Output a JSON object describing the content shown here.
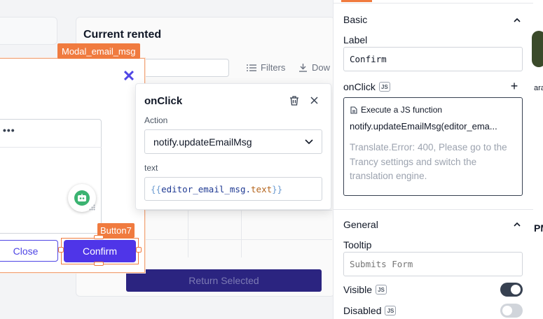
{
  "background": {
    "table_title": "Current rented",
    "filters_label": "Filters",
    "download_label": "Dow",
    "return_button": "Return Selected"
  },
  "modal": {
    "tag": "Modal_email_msg",
    "close_glyph": "✕",
    "editor_menu_glyph": "•••",
    "close_button": "Close",
    "confirm_button": "Confirm",
    "button_tag": "Button7"
  },
  "onclick_popover": {
    "title": "onClick",
    "action_label": "Action",
    "action_value": "notify.updateEmailMsg",
    "text_label": "text",
    "text_value": {
      "open": "{{",
      "object": "editor_email_msg",
      "dot": ".",
      "property": "text",
      "close": "}}"
    }
  },
  "panel": {
    "basic": {
      "title": "Basic",
      "label_label": "Label",
      "label_value": "Confirm",
      "onclick_label": "onClick",
      "js_badge": "JS",
      "add_glyph": "+",
      "action_type": "Execute a JS function",
      "action_function": "notify.updateEmailMsg(editor_ema...",
      "action_error": "Translate.Error: 400, Please go to the Trancy settings and switch the translation engine."
    },
    "general": {
      "title": "General",
      "tooltip_label": "Tooltip",
      "tooltip_placeholder": "Submits Form",
      "visible_label": "Visible",
      "visible_on": true,
      "disabled_label": "Disabled",
      "disabled_on": false
    }
  },
  "peek": {
    "text_a": "ara",
    "text_b": "PM"
  },
  "colors": {
    "accent_orange": "#f07b3f",
    "brand_purple": "#4f35e8",
    "toggle_on": "#374151",
    "toggle_off": "#d1d5db"
  }
}
